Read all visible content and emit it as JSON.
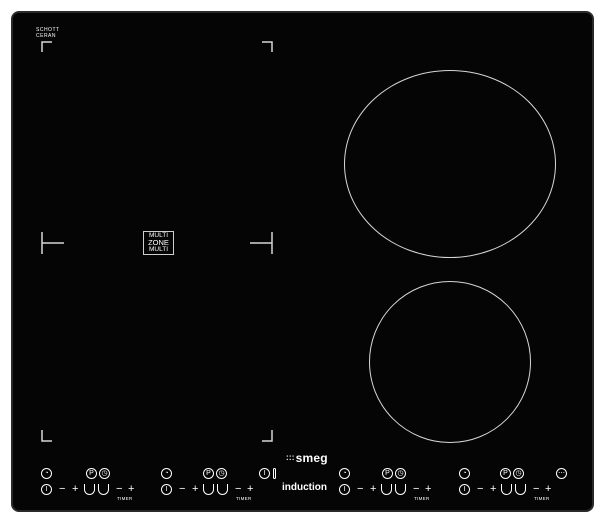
{
  "appliance": {
    "corner_label_lines": [
      "SCHOTT",
      "CERAN"
    ],
    "multizone_lines": [
      "MULTI",
      "ZONE",
      "MULTI"
    ],
    "brand": "smeg",
    "brand_dots": ":::",
    "subtitle": "induction",
    "timer_label": "TIMER",
    "plus": "+",
    "minus": "−"
  },
  "colors": {
    "glass": "#050505",
    "frame": "#2a2a2a",
    "marking": "#d7d7d7",
    "text": "#ffffff"
  },
  "icons": [
    "zone-indicator-icon",
    "pause-icon",
    "clock-icon",
    "power-icon",
    "lock-icon",
    "heat-level-icon"
  ]
}
